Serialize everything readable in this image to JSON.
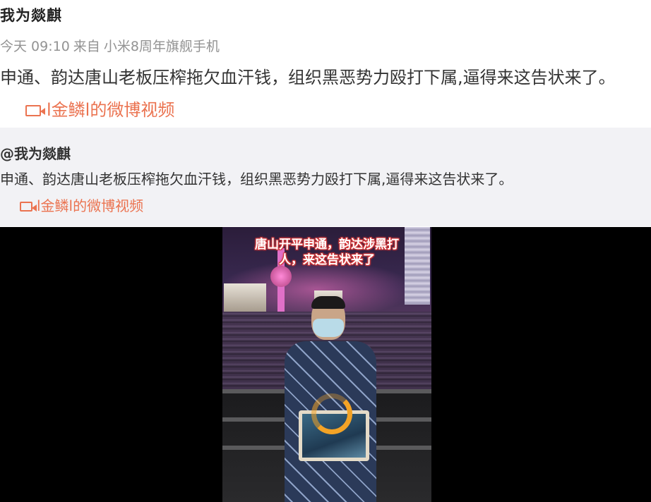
{
  "post": {
    "author": "我为燚麒",
    "time": "今天 09:10",
    "source_prefix": "来自",
    "source": "小米8周年旗舰手机",
    "text": "申通、韵达唐山老板压榨拖欠血汗钱，组织黑恶势力殴打下属,逼得来这告状来了。",
    "link_label": "l金鳞l的微博视频"
  },
  "repost": {
    "author": "@我为燚麒",
    "text": "申通、韵达唐山老板压榨拖欠血汗钱，组织黑恶势力殴打下属,逼得来这告状来了。",
    "link_label": "l金鳞l的微博视频"
  },
  "video": {
    "caption_line1": "唐山开平申通，韵达涉黑打",
    "caption_line2": "人，来这告状来了",
    "loading_color": "#f3a326"
  },
  "colors": {
    "link": "#eb7350",
    "meta": "#939393",
    "repost_bg": "#f2f2f5",
    "player_bg": "#000000"
  },
  "icons": {
    "video_link": "video-camera-icon",
    "loading": "loading-spinner-icon"
  }
}
